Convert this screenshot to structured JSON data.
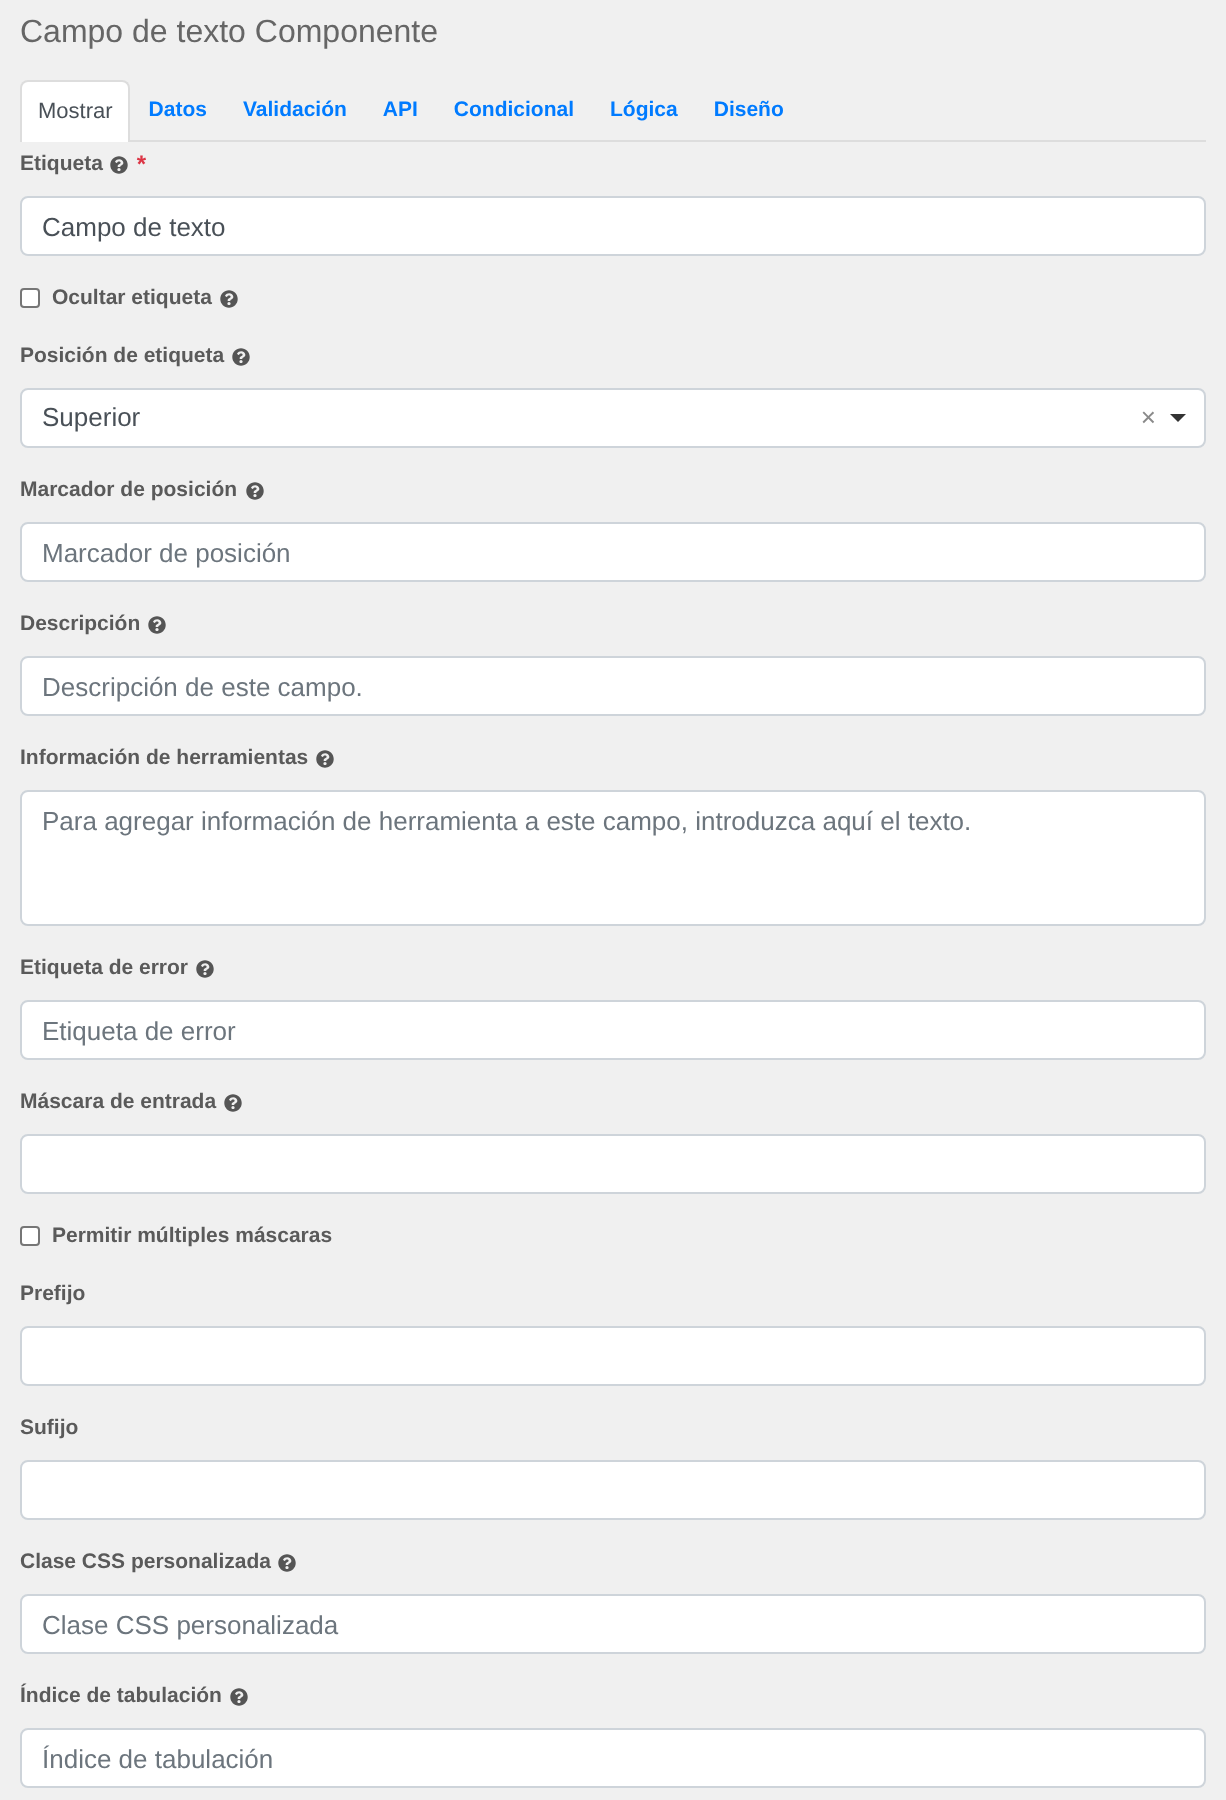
{
  "title": "Campo de texto Componente",
  "tabs": [
    {
      "label": "Mostrar",
      "selected": true
    },
    {
      "label": "Datos",
      "selected": false
    },
    {
      "label": "Validación",
      "selected": false
    },
    {
      "label": "API",
      "selected": false
    },
    {
      "label": "Condicional",
      "selected": false
    },
    {
      "label": "Lógica",
      "selected": false
    },
    {
      "label": "Diseño",
      "selected": false
    }
  ],
  "fields": [
    {
      "kind": "text",
      "label": "Etiqueta",
      "help": true,
      "required_mark": "*",
      "value": "Campo de texto"
    },
    {
      "kind": "checkbox",
      "label": "Ocultar etiqueta",
      "help": true,
      "checked": false
    },
    {
      "kind": "select",
      "label": "Posición de etiqueta",
      "help": true,
      "value": "Superior",
      "clear": "×"
    },
    {
      "kind": "text",
      "label": "Marcador de posición",
      "help": true,
      "placeholder": "Marcador de posición"
    },
    {
      "kind": "text",
      "label": "Descripción",
      "help": true,
      "placeholder": "Descripción de este campo."
    },
    {
      "kind": "textarea",
      "label": "Información de herramientas",
      "help": true,
      "placeholder": "Para agregar información de herramienta a este campo, introduzca aquí el texto."
    },
    {
      "kind": "text",
      "label": "Etiqueta de error",
      "help": true,
      "placeholder": "Etiqueta de error"
    },
    {
      "kind": "text",
      "label": "Máscara de entrada",
      "help": true
    },
    {
      "kind": "checkbox",
      "label": "Permitir múltiples máscaras",
      "help": false,
      "checked": false
    },
    {
      "kind": "text",
      "label": "Prefijo",
      "help": false
    },
    {
      "kind": "text",
      "label": "Sufijo",
      "help": false
    },
    {
      "kind": "text",
      "label": "Clase CSS personalizada",
      "help": true,
      "placeholder": "Clase CSS personalizada"
    },
    {
      "kind": "text",
      "label": "Índice de tabulación",
      "help": true,
      "placeholder": "Índice de tabulación"
    }
  ]
}
